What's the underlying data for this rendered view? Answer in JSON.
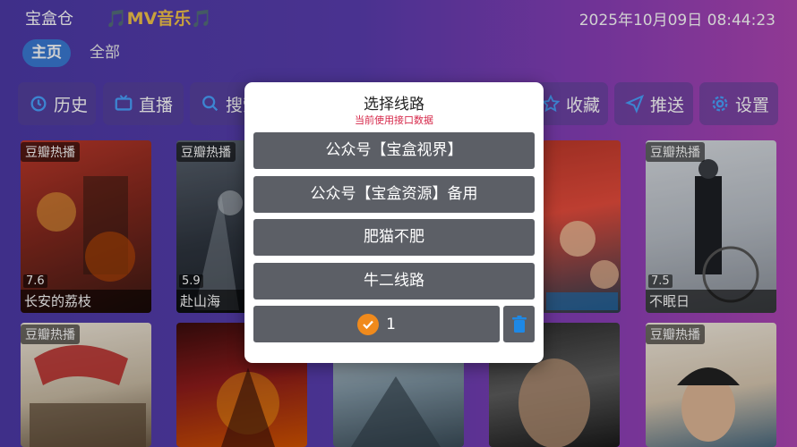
{
  "header": {
    "app_name": "宝盒仓",
    "banner": "🎵MV音乐🎵",
    "datetime": "2025年10月09日 08:44:23"
  },
  "nav": {
    "tabs": [
      {
        "label": "主页",
        "active": true
      },
      {
        "label": "全部",
        "active": false
      }
    ]
  },
  "quick_buttons": {
    "history": "历史",
    "live": "直播",
    "search": "搜索",
    "favorites": "收藏",
    "push": "推送",
    "settings": "设置"
  },
  "accent_colors": {
    "icon_blue": "#4aa3ff",
    "icon_orange": "#f08a1c",
    "dialog_subtitle": "#d6284a",
    "active_tab": "#3a7bd5"
  },
  "cards": [
    {
      "tag": "豆瓣热播",
      "score": "7.6",
      "title": "长安的荔枝"
    },
    {
      "tag": "豆瓣热播",
      "score": "5.9",
      "title": "赴山海"
    },
    {
      "tag": "豆瓣热播",
      "score": "7.5",
      "title": "不眠日"
    },
    {
      "tag": "豆瓣热播"
    },
    {
      "tag": "豆瓣热播"
    },
    {
      "tag": "豆瓣热播"
    }
  ],
  "dialog": {
    "title": "选择线路",
    "subtitle": "当前使用接口数据",
    "routes": [
      "公众号【宝盒视界】",
      "公众号【宝盒资源】备用",
      "肥猫不肥",
      "牛二线路"
    ],
    "current_api": "1"
  }
}
